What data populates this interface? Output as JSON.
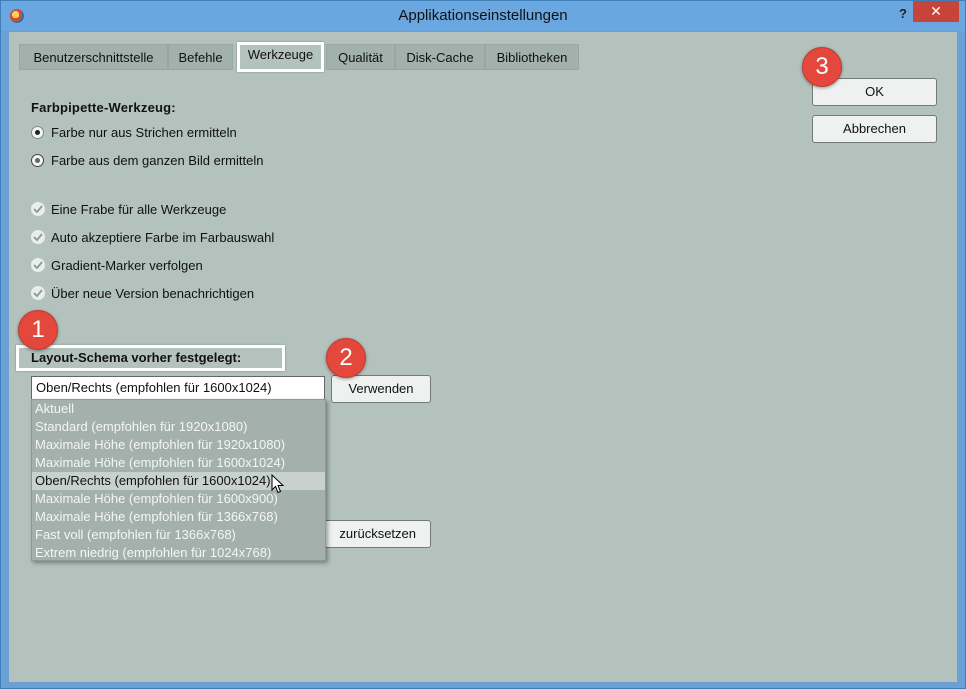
{
  "window": {
    "title": "Applikationseinstellungen",
    "help_label": "?",
    "close_label": "✕"
  },
  "tabs": [
    {
      "label": "Benutzerschnittstelle",
      "active": false
    },
    {
      "label": "Befehle",
      "active": false
    },
    {
      "label": "Werkzeuge",
      "active": true
    },
    {
      "label": "Qualität",
      "active": false
    },
    {
      "label": "Disk-Cache",
      "active": false
    },
    {
      "label": "Bibliotheken",
      "active": false
    }
  ],
  "eyedropper": {
    "title": "Farbpipette-Werkzeug:",
    "options": [
      {
        "label": "Farbe nur aus Strichen ermitteln",
        "selected": true
      },
      {
        "label": "Farbe aus dem ganzen Bild ermitteln",
        "selected": false
      }
    ]
  },
  "checkboxes": [
    {
      "label": "Eine Frabe für alle Werkzeuge",
      "checked": true
    },
    {
      "label": "Auto akzeptiere Farbe im Farbauswahl",
      "checked": true
    },
    {
      "label": "Gradient-Marker verfolgen",
      "checked": true
    },
    {
      "label": "Über neue Version benachrichtigen",
      "checked": true
    }
  ],
  "layout": {
    "title": "Layout-Schema vorher festgelegt:",
    "selected": "Oben/Rechts (empfohlen für 1600x1024)",
    "use_button": "Verwenden",
    "reset_button": "zurücksetzen",
    "options": [
      "Aktuell",
      "Standard (empfohlen für 1920x1080)",
      "Maximale Höhe (empfohlen für 1920x1080)",
      "Maximale Höhe (empfohlen für 1600x1024)",
      "Oben/Rechts (empfohlen für 1600x1024)",
      "Maximale Höhe (empfohlen für 1600x900)",
      "Maximale Höhe (empfohlen für 1366x768)",
      "Fast voll (empfohlen für 1366x768)",
      "Extrem niedrig (empfohlen für 1024x768)"
    ],
    "highlighted_index": 4
  },
  "buttons": {
    "ok": "OK",
    "cancel": "Abbrechen"
  },
  "badges": [
    "1",
    "2",
    "3"
  ],
  "colors": {
    "client_bg": "#b3c2bc",
    "badge": "#e4473c",
    "close": "#c7443a"
  }
}
